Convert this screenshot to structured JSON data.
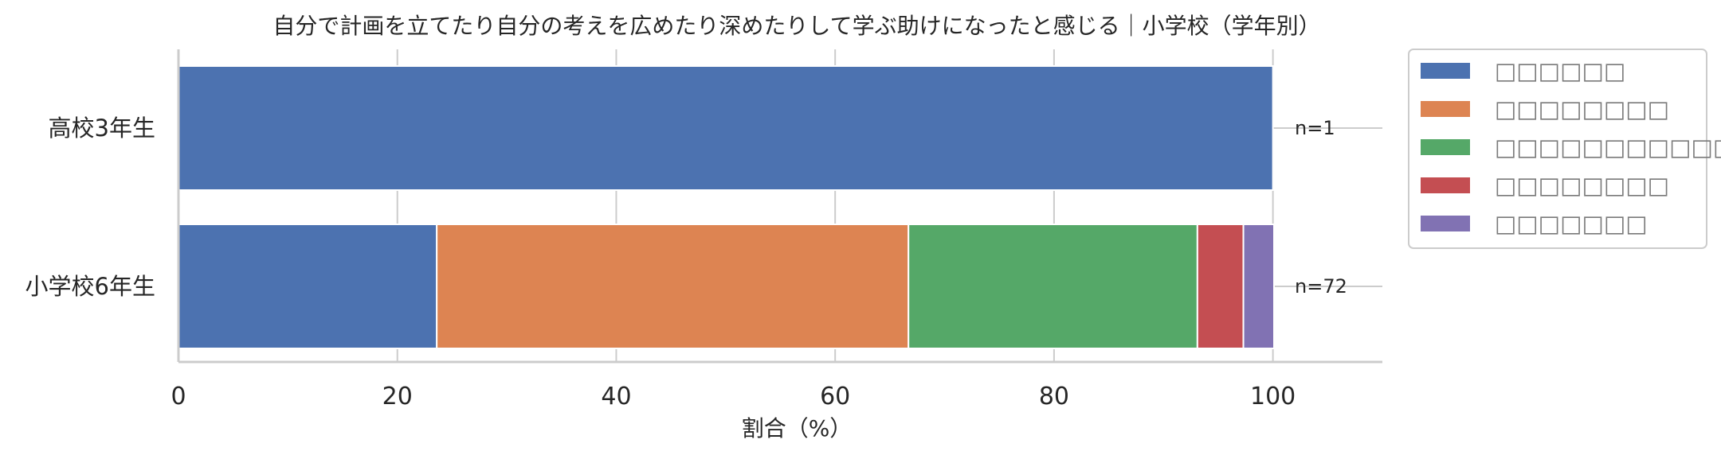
{
  "chart_data": {
    "type": "bar",
    "orientation": "horizontal",
    "stacked": true,
    "title": "自分で計画を立てたり自分の考えを広めたり深めたりして学ぶ助けになったと感じる｜小学校（学年別）",
    "xlabel": "割合（%）",
    "ylabel": "",
    "xlim": [
      0,
      110
    ],
    "xticks": [
      "0",
      "20",
      "40",
      "60",
      "80",
      "100"
    ],
    "grid": true,
    "legend_position": "outside-right",
    "categories": [
      "高校3年生",
      "小学校6年生"
    ],
    "n_labels": [
      "n=1",
      "n=72"
    ],
    "series": [
      {
        "name": "□□□□□□",
        "color": "#4c72b0",
        "values": [
          100,
          23.6
        ]
      },
      {
        "name": "□□□□□□□□",
        "color": "#dd8452",
        "values": [
          0,
          43.1
        ]
      },
      {
        "name": "□□□□□□□□□□□□",
        "color": "#55a868",
        "values": [
          0,
          26.4
        ]
      },
      {
        "name": "□□□□□□□□",
        "color": "#c44e52",
        "values": [
          0,
          4.2
        ]
      },
      {
        "name": "□□□□□□□",
        "color": "#8172b3",
        "values": [
          0,
          2.8
        ]
      }
    ]
  }
}
